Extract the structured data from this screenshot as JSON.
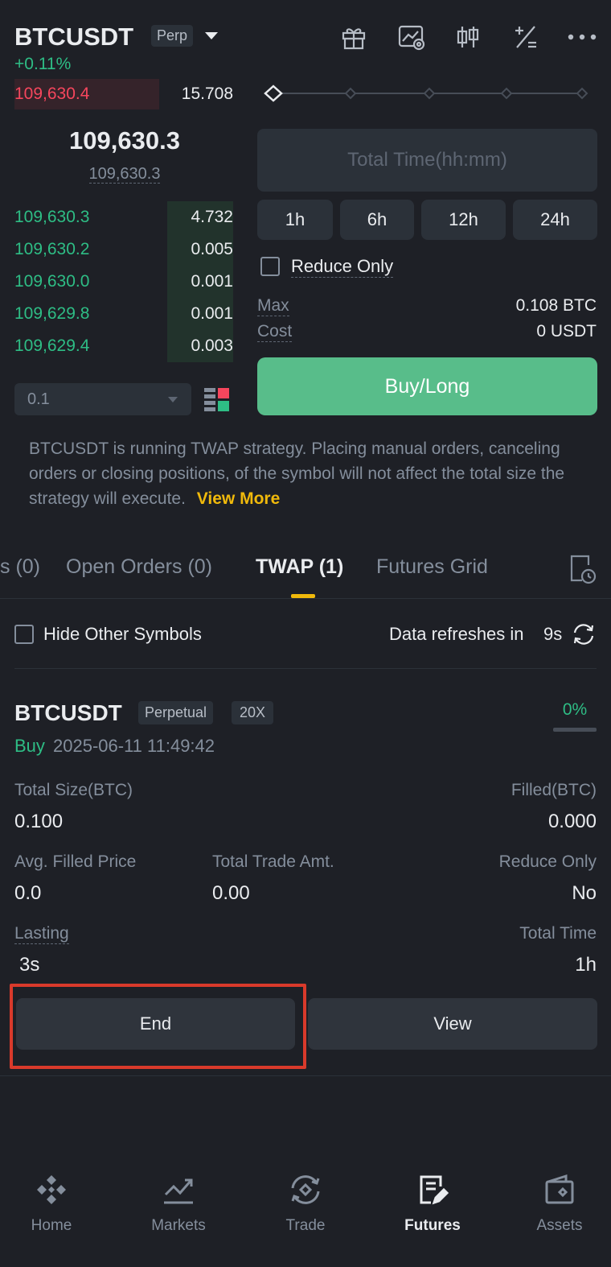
{
  "header": {
    "symbol": "BTCUSDT",
    "contract_badge": "Perp",
    "change": "+0.11%"
  },
  "orderbook": {
    "ask": {
      "price": "109,630.4",
      "qty": "15.708"
    },
    "last_price": "109,630.3",
    "mark_price": "109,630.3",
    "bids": [
      {
        "price": "109,630.3",
        "qty": "4.732",
        "depth": 0.3
      },
      {
        "price": "109,630.2",
        "qty": "0.005",
        "depth": 0.3
      },
      {
        "price": "109,630.0",
        "qty": "0.001",
        "depth": 0.3
      },
      {
        "price": "109,629.8",
        "qty": "0.001",
        "depth": 0.3
      },
      {
        "price": "109,629.4",
        "qty": "0.003",
        "depth": 0.3
      }
    ],
    "precision": "0.1"
  },
  "order_form": {
    "total_time_placeholder": "Total Time(hh:mm)",
    "presets": [
      "1h",
      "6h",
      "12h",
      "24h"
    ],
    "reduce_only_label": "Reduce Only",
    "max_label": "Max",
    "max_value": "0.108 BTC",
    "cost_label": "Cost",
    "cost_value": "0 USDT",
    "buy_button": "Buy/Long"
  },
  "notice": {
    "text": "BTCUSDT is running TWAP strategy. Placing manual orders, canceling orders or closing positions, of the symbol will not affect the total size the strategy will execute.",
    "link": "View More"
  },
  "tabs": {
    "items": [
      "s (0)",
      "Open Orders (0)",
      "TWAP (1)",
      "Futures Grid"
    ],
    "active": "TWAP (1)"
  },
  "filter": {
    "hide_other_label": "Hide Other Symbols",
    "refresh_label": "Data refreshes in",
    "refresh_seconds": "9s"
  },
  "twap_order": {
    "symbol": "BTCUSDT",
    "type_badge": "Perpetual",
    "leverage_badge": "20X",
    "progress": "0%",
    "side": "Buy",
    "timestamp": "2025-06-11 11:49:42",
    "total_size_label": "Total Size(BTC)",
    "total_size": "0.100",
    "filled_label": "Filled(BTC)",
    "filled": "0.000",
    "avg_price_label": "Avg. Filled Price",
    "avg_price": "0.0",
    "trade_amt_label": "Total Trade Amt.",
    "trade_amt": "0.00",
    "reduce_only_label": "Reduce Only",
    "reduce_only": "No",
    "lasting_label": "Lasting",
    "lasting": "3s",
    "total_time_label": "Total Time",
    "total_time": "1h",
    "end_button": "End",
    "view_button": "View"
  },
  "bottom_nav": [
    "Home",
    "Markets",
    "Trade",
    "Futures",
    "Assets"
  ],
  "colors": {
    "background": "#1e2026",
    "green": "#2ebd85",
    "buy_button": "#58bd8a",
    "red": "#f6465d",
    "accent_yellow": "#f0b90b",
    "highlight_box": "#d93a2b"
  }
}
